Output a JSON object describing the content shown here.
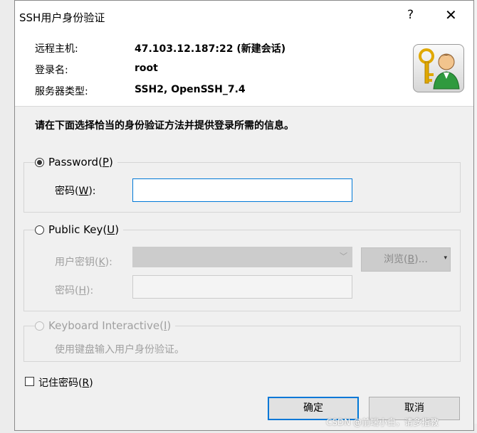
{
  "window": {
    "title": "SSH用户身份验证",
    "help_glyph": "?",
    "close_glyph": "✕"
  },
  "info": {
    "remote_host_label": "远程主机:",
    "remote_host_value": "47.103.12.187:22 (新建会话)",
    "login_label": "登录名:",
    "login_value": "root",
    "server_type_label": "服务器类型:",
    "server_type_value": "SSH2, OpenSSH_7.4"
  },
  "instruction": "请在下面选择恰当的身份验证方法并提供登录所需的信息。",
  "password_method": {
    "label_prefix": "Password(",
    "accel": "P",
    "label_suffix": ")",
    "selected": true,
    "field_label_prefix": "密码(",
    "field_accel": "W",
    "field_label_suffix": "):",
    "value": ""
  },
  "publickey_method": {
    "label_prefix": "Public Key(",
    "accel": "U",
    "label_suffix": ")",
    "selected": false,
    "key_label_prefix": "用户密钥(",
    "key_accel": "K",
    "key_label_suffix": "):",
    "key_value": "",
    "passphrase_label_prefix": "密码(",
    "passphrase_accel": "H",
    "passphrase_label_suffix": "):",
    "passphrase_value": "",
    "browse_prefix": "浏览(",
    "browse_accel": "B",
    "browse_suffix": ")..."
  },
  "keyboard_method": {
    "label_prefix": "Keyboard Interactive(",
    "accel": "I",
    "label_suffix": ")",
    "description": "使用键盘输入用户身份验证。"
  },
  "remember": {
    "label_prefix": "记住密码(",
    "accel": "R",
    "label_suffix": ")",
    "checked": false
  },
  "buttons": {
    "ok": "确定",
    "cancel": "取消"
  },
  "watermark": "CSDN @前端小白，请多指教"
}
